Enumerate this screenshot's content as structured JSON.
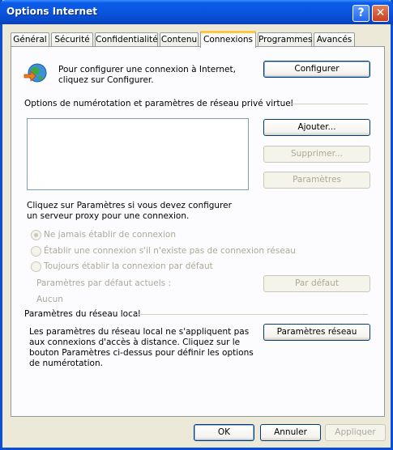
{
  "window": {
    "title": "Options Internet"
  },
  "tabs": [
    "Général",
    "Sécurité",
    "Confidentialité",
    "Contenu",
    "Connexions",
    "Programmes",
    "Avancés"
  ],
  "setup": {
    "text": "Pour configurer une connexion à Internet, cliquez sur Configurer.",
    "button": "Configurer"
  },
  "dialup": {
    "heading": "Options de numérotation et paramètres de réseau privé virtuel",
    "add": "Ajouter...",
    "remove": "Supprimer...",
    "settings": "Paramètres",
    "proxy_hint": "Cliquez sur Paramètres si vous devez configurer un serveur proxy pour une connexion.",
    "radio_never": "Ne jamais établir de connexion",
    "radio_when_none": "Établir une connexion s'il n'existe pas de connexion réseau",
    "radio_always": "Toujours établir la connexion par défaut",
    "current_default_label": "Paramètres par défaut actuels :",
    "current_default_value": "Aucun",
    "set_default": "Par défaut"
  },
  "lan": {
    "heading": "Paramètres du réseau local",
    "text": "Les paramètres du réseau local ne s'appliquent pas aux connexions d'accès à distance. Cliquez sur le bouton Paramètres ci-dessus pour définir les options de numérotation.",
    "button": "Paramètres réseau"
  },
  "footer": {
    "ok": "OK",
    "cancel": "Annuler",
    "apply": "Appliquer"
  }
}
